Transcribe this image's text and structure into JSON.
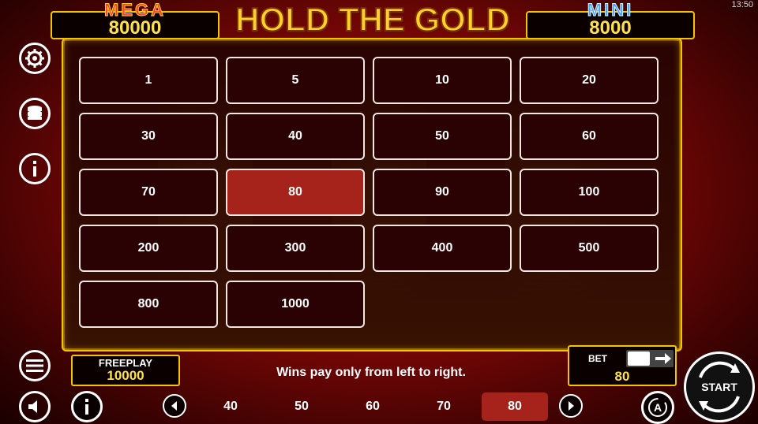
{
  "status_bar": {
    "time": "13:50"
  },
  "jackpots": {
    "mega": {
      "title": "MEGA",
      "value": "80000"
    },
    "mini": {
      "title": "MINI",
      "value": "8000"
    }
  },
  "logo": {
    "text": "HOLD THE GOLD"
  },
  "side_menu": {
    "items": [
      {
        "icon": "gear-icon"
      },
      {
        "icon": "coins-stack-icon"
      },
      {
        "icon": "info-icon"
      },
      {
        "icon": "hamburger-menu-icon"
      },
      {
        "icon": "speaker-icon"
      }
    ]
  },
  "bet_grid": {
    "values": [
      "1",
      "5",
      "10",
      "20",
      "30",
      "40",
      "50",
      "60",
      "70",
      "80",
      "90",
      "100",
      "200",
      "300",
      "400",
      "500",
      "800",
      "1000"
    ],
    "selected": "80"
  },
  "freeplay": {
    "label": "FREEPLAY",
    "value": "10000"
  },
  "message": "Wins pay only from left to right.",
  "bet": {
    "label": "BET",
    "value": "80"
  },
  "bet_strip": {
    "items": [
      "40",
      "50",
      "60",
      "70",
      "80"
    ],
    "selected": "80"
  },
  "start_button": {
    "label": "START"
  },
  "colors": {
    "gold": "#f5c400",
    "selected": "#a5231b",
    "value_yellow": "#ffe24a",
    "cell_bg": "#2a0203"
  }
}
